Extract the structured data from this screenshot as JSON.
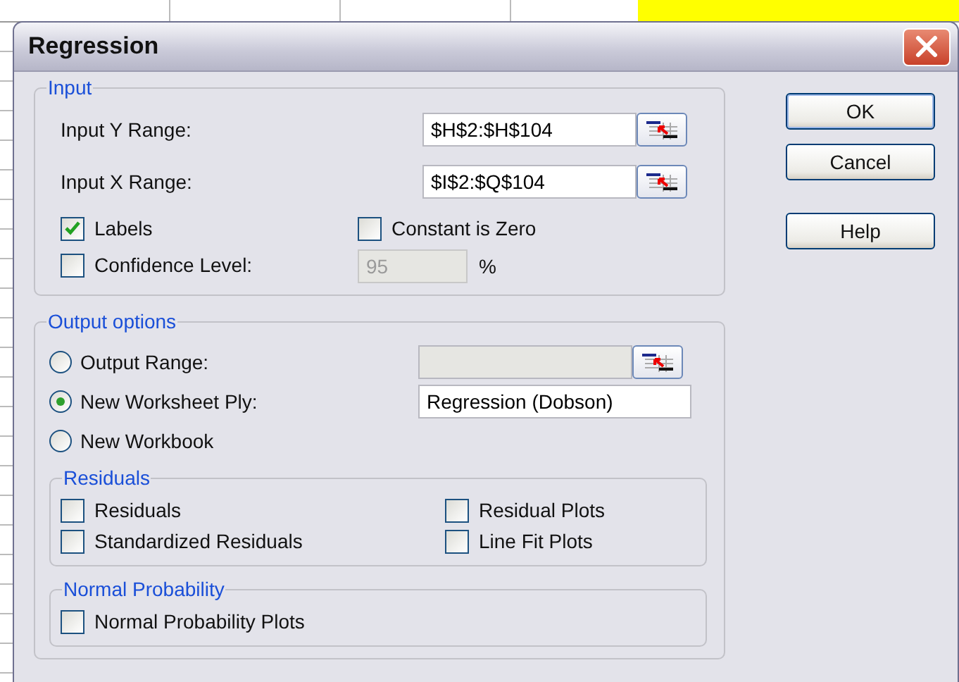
{
  "window": {
    "title": "Regression"
  },
  "input": {
    "legend": "Input",
    "ranges": [
      {
        "label": "Input Y Range:",
        "value": "$H$2:$H$104"
      },
      {
        "label": "Input X Range:",
        "value": "$I$2:$Q$104"
      }
    ],
    "options": [
      {
        "label": "Labels",
        "checked": true
      },
      {
        "label": "Constant is Zero",
        "checked": false
      }
    ],
    "confidence": {
      "label": "Confidence Level:",
      "checked": false,
      "value": "95",
      "unit": "%",
      "disabled": true
    }
  },
  "output": {
    "legend": "Output options",
    "choices": [
      {
        "label": "Output Range:",
        "selected": false,
        "field": {
          "kind": "range",
          "disabled": true
        }
      },
      {
        "label": "New Worksheet Ply:",
        "selected": true,
        "field": {
          "kind": "text",
          "value": "Regression (Dobson)",
          "disabled": false
        }
      },
      {
        "label": "New Workbook",
        "selected": false
      }
    ]
  },
  "residuals": {
    "legend": "Residuals",
    "options": [
      {
        "label": "Residuals",
        "checked": false
      },
      {
        "label": "Residual Plots",
        "checked": false
      },
      {
        "label": "Standardized Residuals",
        "checked": false
      },
      {
        "label": "Line Fit Plots",
        "checked": false
      }
    ]
  },
  "normal_probability": {
    "legend": "Normal Probability",
    "options": [
      {
        "label": "Normal Probability Plots",
        "checked": false
      }
    ]
  },
  "buttons": [
    {
      "label": "OK",
      "kind": "default"
    },
    {
      "label": "Cancel",
      "kind": "normal"
    },
    {
      "label": "Help",
      "kind": "help"
    }
  ]
}
